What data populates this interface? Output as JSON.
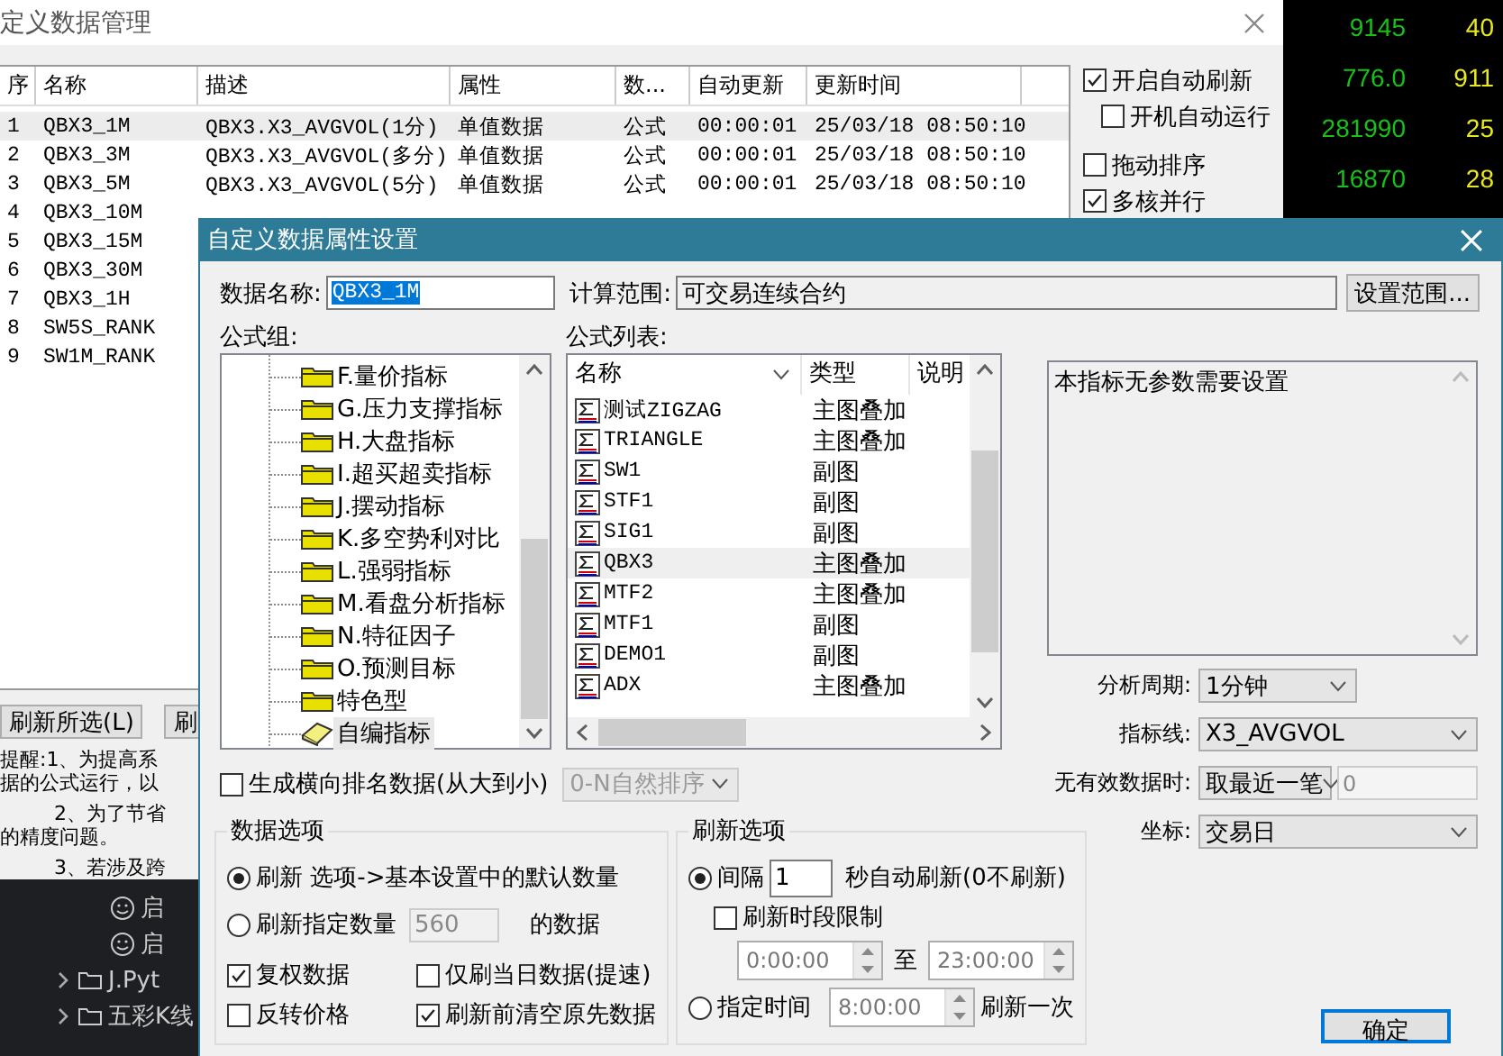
{
  "back_window": {
    "title": "定义数据管理",
    "table": {
      "columns": [
        "序",
        "名称",
        "描述",
        "属性",
        "数...",
        "自动更新",
        "更新时间"
      ],
      "rows": [
        {
          "cells": [
            "1",
            "QBX3_1M",
            "QBX3.X3_AVGVOL(1分)",
            "单值数据",
            "公式",
            "00:00:01",
            "25/03/18 08:50:10"
          ],
          "selected": true
        },
        {
          "cells": [
            "2",
            "QBX3_3M",
            "QBX3.X3_AVGVOL(多分)",
            "单值数据",
            "公式",
            "00:00:01",
            "25/03/18 08:50:10"
          ],
          "selected": false
        },
        {
          "cells": [
            "3",
            "QBX3_5M",
            "QBX3.X3_AVGVOL(5分)",
            "单值数据",
            "公式",
            "00:00:01",
            "25/03/18 08:50:10"
          ],
          "selected": false
        },
        {
          "cells": [
            "4",
            "QBX3_10M"
          ],
          "selected": false
        },
        {
          "cells": [
            "5",
            "QBX3_15M"
          ],
          "selected": false
        },
        {
          "cells": [
            "6",
            "QBX3_30M"
          ],
          "selected": false
        },
        {
          "cells": [
            "7",
            "QBX3_1H"
          ],
          "selected": false
        },
        {
          "cells": [
            "8",
            "SW5S_RANK"
          ],
          "selected": false
        },
        {
          "cells": [
            "9",
            "SW1M_RANK"
          ],
          "selected": false
        }
      ]
    },
    "options": [
      {
        "label": "开启自动刷新",
        "checked": true,
        "children": [
          {
            "label": "开机自动运行",
            "checked": false
          }
        ]
      },
      {
        "label": "拖动排序",
        "checked": false
      },
      {
        "label": "多核并行",
        "checked": true
      }
    ],
    "buttons": [
      "刷新所选(L)",
      "刷"
    ],
    "notice_lines": [
      "提醒:1、为提高系",
      "据的公式运行，以",
      "2、为了节省",
      "的精度问题。",
      "3、若涉及跨"
    ]
  },
  "ticker": {
    "rows": [
      {
        "values": [
          "9145",
          "40"
        ]
      },
      {
        "values": [
          "776.0",
          "911"
        ]
      },
      {
        "values": [
          "281990",
          "25"
        ]
      },
      {
        "values": [
          "16870",
          "28"
        ]
      }
    ]
  },
  "explorer_tree": [
    {
      "children": [
        {
          "children": [
            {
              "label": "启",
              "kind": "smiley"
            },
            {
              "label": "启",
              "kind": "smiley"
            }
          ]
        },
        {
          "label": "J.Pyt",
          "kind": "folder",
          "expanded": false
        }
      ]
    },
    {
      "label": "五彩K线",
      "kind": "folder",
      "expanded": false
    }
  ],
  "dialog": {
    "title": "自定义数据属性设置",
    "name_label": "数据名称:",
    "name_value": "QBX3_1M",
    "name_text_selected": true,
    "range_label": "计算范围:",
    "range_value": "可交易连续合约",
    "range_button": "设置范围...",
    "groups_label": "公式组:",
    "groups": [
      {
        "label": "F.量价指标",
        "kind": "folder",
        "selected": false
      },
      {
        "label": "G.压力支撑指标",
        "kind": "folder",
        "selected": false
      },
      {
        "label": "H.大盘指标",
        "kind": "folder",
        "selected": false
      },
      {
        "label": "I.超买超卖指标",
        "kind": "folder",
        "selected": false
      },
      {
        "label": "J.摆动指标",
        "kind": "folder",
        "selected": false
      },
      {
        "label": "K.多空势利对比",
        "kind": "folder",
        "selected": false
      },
      {
        "label": "L.强弱指标",
        "kind": "folder",
        "selected": false
      },
      {
        "label": "M.看盘分析指标",
        "kind": "folder",
        "selected": false
      },
      {
        "label": "N.特征因子",
        "kind": "folder",
        "selected": false
      },
      {
        "label": "O.预测目标",
        "kind": "folder",
        "selected": false
      },
      {
        "label": "特色型",
        "kind": "folder",
        "selected": false
      },
      {
        "label": "自编指标",
        "kind": "custom",
        "selected": true
      }
    ],
    "formulas_label": "公式列表:",
    "formula_columns": [
      "名称",
      "类型",
      "说明"
    ],
    "formulas": [
      {
        "name": "测试ZIGZAG",
        "type": "主图叠加",
        "selected": false
      },
      {
        "name": "TRIANGLE",
        "type": "主图叠加",
        "selected": false
      },
      {
        "name": "SW1",
        "type": "副图",
        "selected": false
      },
      {
        "name": "STF1",
        "type": "副图",
        "selected": false
      },
      {
        "name": "SIG1",
        "type": "副图",
        "selected": false
      },
      {
        "name": "QBX3",
        "type": "主图叠加",
        "selected": true
      },
      {
        "name": "MTF2",
        "type": "主图叠加",
        "selected": false
      },
      {
        "name": "MTF1",
        "type": "副图",
        "selected": false
      },
      {
        "name": "DEMO1",
        "type": "副图",
        "selected": false
      },
      {
        "name": "ADX",
        "type": "主图叠加",
        "selected": false
      }
    ],
    "description": "本指标无参数需要设置",
    "settings": [
      {
        "label": "分析周期:",
        "value": "1分钟",
        "kind": "short"
      },
      {
        "label": "指标线:",
        "value": "X3_AVGVOL",
        "kind": "wide"
      },
      {
        "label": "无有效数据时:",
        "value": "取最近一笔",
        "kind": "with_field",
        "field": "0"
      },
      {
        "label": "坐标:",
        "value": "交易日",
        "kind": "wide"
      }
    ],
    "rank": {
      "label": "生成横向排名数据(从大到小)",
      "checked": false,
      "order": "0-N自然排序",
      "disabled": true
    },
    "data_options": {
      "title": "数据选项",
      "radios": [
        {
          "label": "刷新 选项->基本设置中的默认数量",
          "selected": true
        },
        {
          "label": "刷新指定数量",
          "field": "560",
          "suffix": "的数据",
          "selected": false
        }
      ],
      "checks": [
        {
          "label": "复权数据",
          "checked": true
        },
        {
          "label": "仅刷当日数据(提速)",
          "checked": false
        },
        {
          "label": "反转价格",
          "checked": false
        },
        {
          "label": "刷新前清空原先数据",
          "checked": true
        }
      ]
    },
    "refresh_options": {
      "title": "刷新选项",
      "interval": {
        "label": "间隔",
        "value": "1",
        "suffix": "秒自动刷新(0不刷新)",
        "selected": true
      },
      "limit": {
        "label": "刷新时段限制",
        "checked": false,
        "from": "0:00:00",
        "to_label": "至",
        "to": "23:00:00"
      },
      "fixed": {
        "label": "指定时间",
        "value": "8:00:00",
        "suffix": "刷新一次",
        "selected": false
      }
    },
    "ok_button": "确定"
  }
}
